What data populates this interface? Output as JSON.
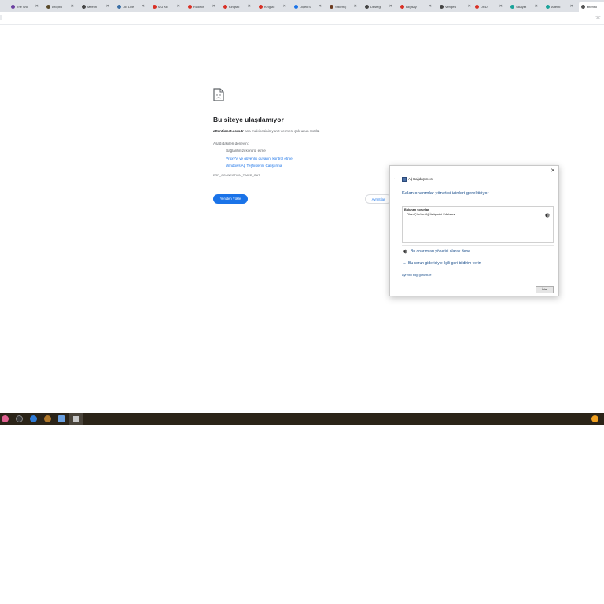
{
  "tabs": [
    {
      "title": "The Wo",
      "color": "#6b3fa0"
    },
    {
      "title": "Dropbo",
      "color": "#5a4a2a"
    },
    {
      "title": "Meetin",
      "color": "#444444"
    },
    {
      "title": "OE Live",
      "color": "#3a6ea5"
    },
    {
      "title": "MU XE",
      "color": "#d93025"
    },
    {
      "title": "Radeon",
      "color": "#d93025"
    },
    {
      "title": "Kingsto",
      "color": "#d93025"
    },
    {
      "title": "Kingsto",
      "color": "#d93025"
    },
    {
      "title": "Ölçek S",
      "color": "#1a73e8"
    },
    {
      "title": "Sistemç",
      "color": "#6b3a1f"
    },
    {
      "title": "Destegi",
      "color": "#444444"
    },
    {
      "title": "Bilgisay",
      "color": "#d93025"
    },
    {
      "title": "Verigesi",
      "color": "#444444"
    },
    {
      "title": "DRD",
      "color": "#d93025"
    },
    {
      "title": "Şikayet",
      "color": "#1aa39a"
    },
    {
      "title": "Attenti",
      "color": "#1aa39a"
    },
    {
      "title": "attentio",
      "color": "#555555"
    }
  ],
  "error": {
    "title": "Bu siteye ulaşılamıyor",
    "host": "attentionet.com.tr",
    "desc_suffix": " ana makinesinin yanıt vermesi çok uzun sürdü.",
    "try_label": "Aşağıdakileri deneyin:",
    "suggestions": [
      "Bağlantınızı kontrol etme",
      "Proxy'yi ve güvenlik duvarını kontrol etme",
      "Windows Ağ Teşhislerini Çalıştırma"
    ],
    "code": "ERR_CONNECTION_TIMED_OUT",
    "reload_label": "Yeniden Yükle",
    "details_label": "Ayrıntılar"
  },
  "dialog": {
    "close": "✕",
    "back": "←",
    "app_title": "Ağ Bağdaştırıcısı",
    "heading": "Kalan onarımlar yönetici izinleri gerektiriyor",
    "panel_heading": "Bulunan sorunlar",
    "panel_item": "Olası Çözüm: Ağ İletişimini Sıfırlama",
    "option_admin": "Bu onarımları yönetici olarak dene",
    "option_feedback": "Bu sorun gidericiyle ilgili geri bildirim verin",
    "more_info": "Ayrıntılı bilgi görüntüle",
    "cancel": "İptal"
  },
  "colors": {
    "link": "#1a73e8",
    "dialog_link": "#1b4f8c",
    "taskbar": "#2b2418",
    "tabstrip": "#dee1e6"
  }
}
